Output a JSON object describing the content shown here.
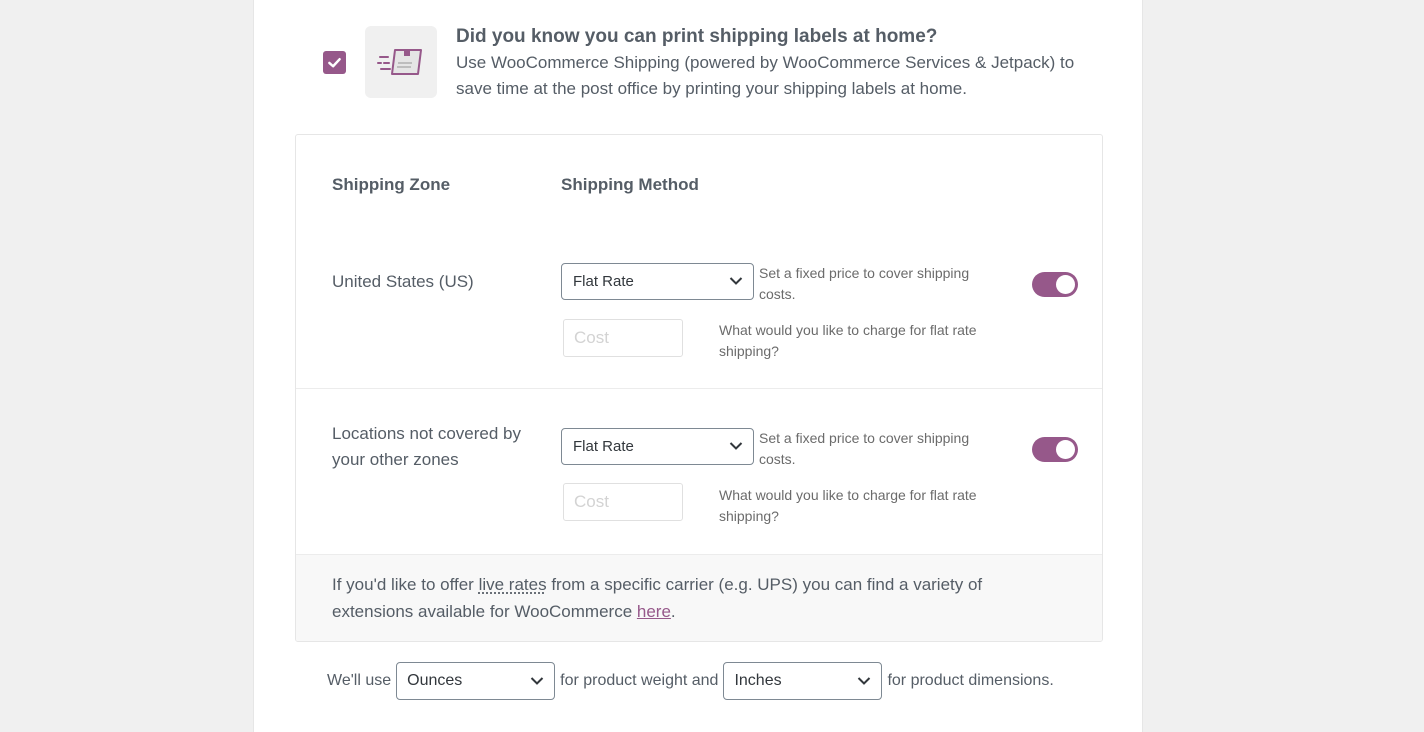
{
  "promo": {
    "checked": true,
    "icon": "shipping-label-icon",
    "title": "Did you know you can print shipping labels at home?",
    "description": "Use WooCommerce Shipping (powered by WooCommerce Services & Jetpack) to save time at the post office by printing your shipping labels at home."
  },
  "shipping": {
    "headers": {
      "zone": "Shipping Zone",
      "method": "Shipping Method"
    },
    "zones": [
      {
        "name": "United States (US)",
        "method": "Flat Rate",
        "method_description": "Set a fixed price to cover shipping costs.",
        "cost_value": "",
        "cost_placeholder": "Cost",
        "cost_description": "What would you like to charge for flat rate shipping?",
        "enabled": true
      },
      {
        "name": "Locations not covered by your other zones",
        "method": "Flat Rate",
        "method_description": "Set a fixed price to cover shipping costs.",
        "cost_value": "",
        "cost_placeholder": "Cost",
        "cost_description": "What would you like to charge for flat rate shipping?",
        "enabled": true
      }
    ],
    "footer": {
      "text_before": "If you'd like to offer ",
      "abbr_text": "live rates",
      "text_middle": " from a specific carrier (e.g. UPS) you can find a variety of extensions available for WooCommerce ",
      "link_text": "here",
      "text_after": "."
    }
  },
  "units": {
    "prefix": "We'll use",
    "weight_unit": "Ounces",
    "middle": "for product weight and",
    "dimension_unit": "Inches",
    "suffix": "for product dimensions."
  },
  "colors": {
    "accent": "#96588a",
    "text": "#555d66",
    "background": "#f0f0f0"
  }
}
